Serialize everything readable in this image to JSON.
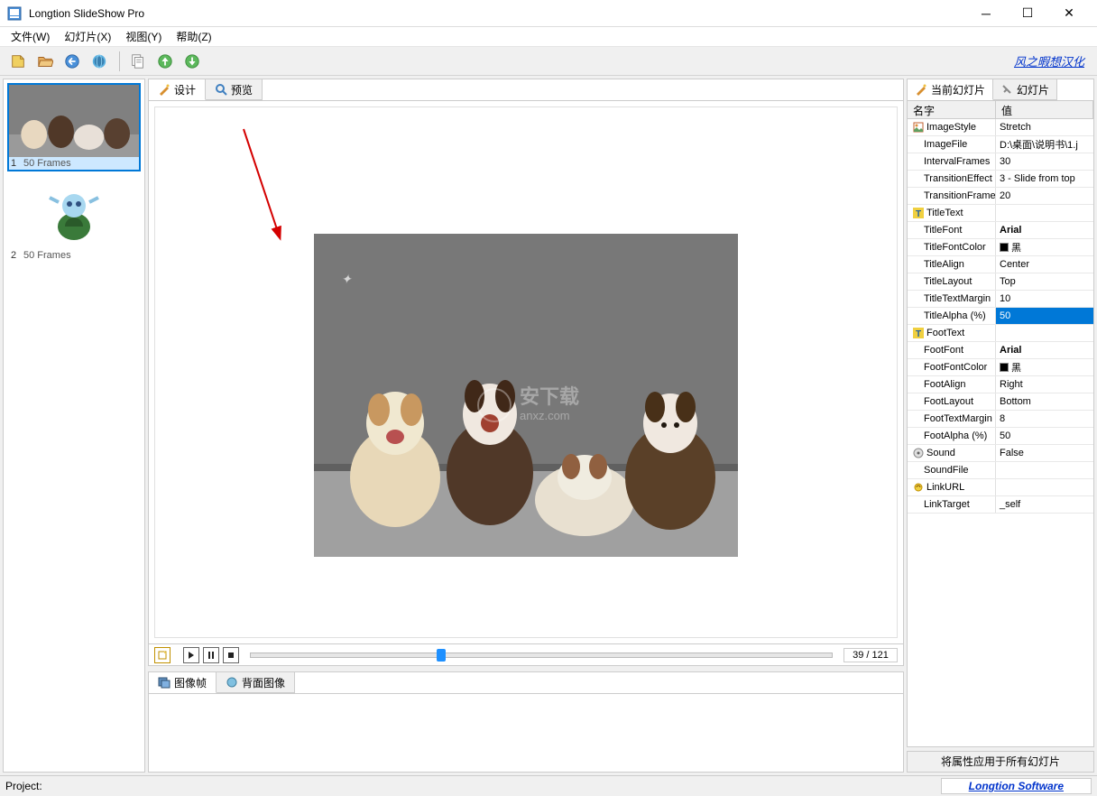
{
  "window": {
    "title": "Longtion SlideShow Pro"
  },
  "menu": {
    "file": "文件(W)",
    "slide": "幻灯片(X)",
    "view": "视图(Y)",
    "help": "帮助(Z)"
  },
  "toolbar": {
    "cn_link": "风之暇想汉化"
  },
  "thumbs": {
    "items": [
      {
        "idx": "1",
        "label": "50 Frames",
        "selected": true
      },
      {
        "idx": "2",
        "label": "50 Frames",
        "selected": false
      }
    ]
  },
  "center_tabs": {
    "design": "设计",
    "preview": "预览"
  },
  "playback": {
    "counter": "39 / 121",
    "slider_percent": 32
  },
  "bottom_tabs": {
    "image_frame": "图像帧",
    "back_image": "背面图像"
  },
  "right_tabs": {
    "current": "当前幻灯片",
    "all": "幻灯片"
  },
  "prop_header": {
    "name": "名字",
    "value": "值"
  },
  "props": [
    {
      "name": "ImageStyle",
      "value": "Stretch",
      "icon": "img"
    },
    {
      "name": "ImageFile",
      "value": "D:\\桌面\\说明书\\1.j",
      "indent": true
    },
    {
      "name": "IntervalFrames",
      "value": "30",
      "indent": true
    },
    {
      "name": "TransitionEffect",
      "value": "3 - Slide from top",
      "indent": true
    },
    {
      "name": "TransitionFrames",
      "value": "20",
      "indent": true
    },
    {
      "name": "TitleText",
      "value": "",
      "icon": "T"
    },
    {
      "name": "TitleFont",
      "value": "Arial",
      "indent": true,
      "bold": true
    },
    {
      "name": "TitleFontColor",
      "value": "黑",
      "indent": true,
      "color": "#000"
    },
    {
      "name": "TitleAlign",
      "value": "Center",
      "indent": true
    },
    {
      "name": "TitleLayout",
      "value": "Top",
      "indent": true
    },
    {
      "name": "TitleTextMargin",
      "value": "10",
      "indent": true
    },
    {
      "name": "TitleAlpha (%)",
      "value": "50",
      "indent": true,
      "selected": true
    },
    {
      "name": "FootText",
      "value": "",
      "icon": "T"
    },
    {
      "name": "FootFont",
      "value": "Arial",
      "indent": true,
      "bold": true
    },
    {
      "name": "FootFontColor",
      "value": "黑",
      "indent": true,
      "color": "#000"
    },
    {
      "name": "FootAlign",
      "value": "Right",
      "indent": true
    },
    {
      "name": "FootLayout",
      "value": "Bottom",
      "indent": true
    },
    {
      "name": "FootTextMargin",
      "value": "8",
      "indent": true
    },
    {
      "name": "FootAlpha (%)",
      "value": "50",
      "indent": true
    },
    {
      "name": "Sound",
      "value": "False",
      "icon": "snd"
    },
    {
      "name": "SoundFile",
      "value": "",
      "indent": true
    },
    {
      "name": "LinkURL",
      "value": "",
      "icon": "link"
    },
    {
      "name": "LinkTarget",
      "value": "_self",
      "indent": true
    }
  ],
  "apply_button": "将属性应用于所有幻灯片",
  "statusbar": {
    "left": "Project:",
    "right": "Longtion Software"
  }
}
